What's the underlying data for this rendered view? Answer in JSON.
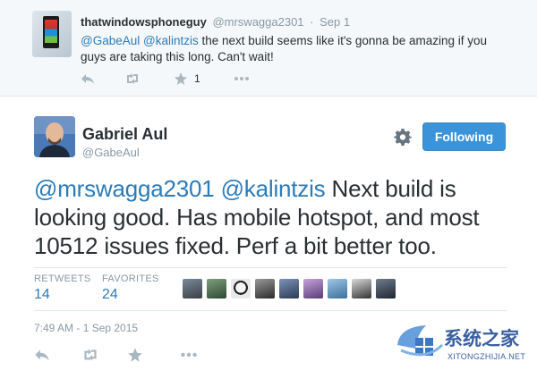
{
  "parent_tweet": {
    "display_name": "thatwindowsphoneguy",
    "handle": "@mrswagga2301",
    "separator": "·",
    "time": "Sep 1",
    "mention1": "@GabeAul",
    "mention2": "@kalintzis",
    "text": " the next build seems like it's gonna be amazing if you guys are taking this long. Can't wait!",
    "favorite_count": "1"
  },
  "tweet": {
    "display_name": "Gabriel Aul",
    "handle": "@GabeAul",
    "follow_label": "Following",
    "mention1": "@mrswagga2301",
    "mention2": "@kalintzis",
    "text": " Next build is looking good. Has mobile hotspot, and most 10512 issues fixed. Perf a bit better too.",
    "retweets_label": "RETWEETS",
    "retweets_count": "14",
    "favorites_label": "FAVORITES",
    "favorites_count": "24",
    "timestamp": "7:49 AM - 1 Sep 2015"
  },
  "watermark": {
    "title": "系统之家",
    "subtitle": "XITONGZHIJIA.NET"
  },
  "icons": [
    "reply-icon",
    "retweet-icon",
    "favorite-icon",
    "more-icon",
    "gear-icon",
    "phone-avatar",
    "windows-logo-icon"
  ],
  "colors": {
    "link": "#2b7bb9",
    "follow_button": "#3b94d9",
    "muted": "#8899a6",
    "icon": "#aab8c2",
    "parent_bg": "#f5f8fa"
  }
}
